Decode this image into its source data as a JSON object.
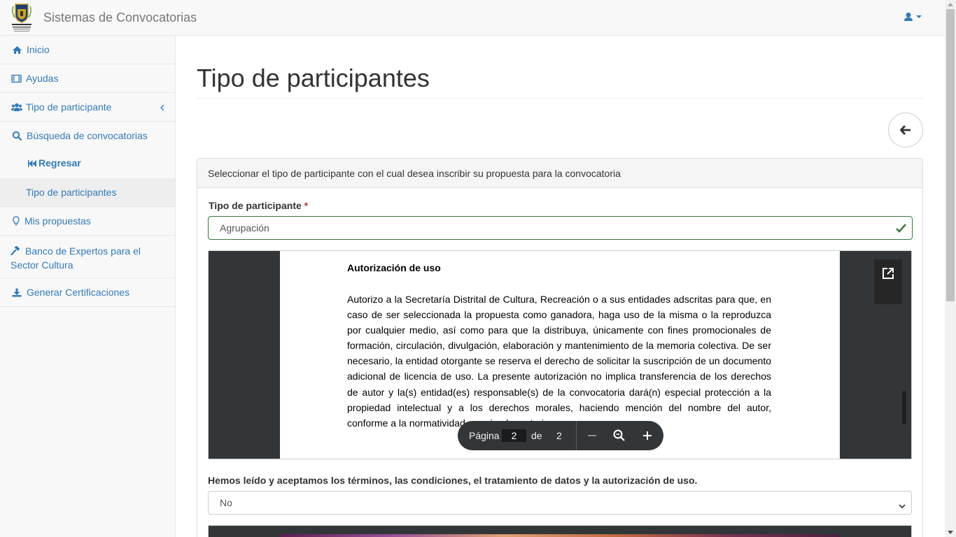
{
  "app": {
    "title": "Sistemas de Convocatorias",
    "logo_icon": "bogota-coat-of-arms-icon"
  },
  "sidebar": {
    "items": [
      {
        "label": "Inicio",
        "icon": "home-icon"
      },
      {
        "label": "Ayudas",
        "icon": "film-icon"
      },
      {
        "label": "Tipo de participante",
        "icon": "users-icon"
      },
      {
        "label": "Búsqueda de convocatorias",
        "icon": "search-icon"
      },
      {
        "label": "Regresar",
        "icon": "fast-backward-icon"
      },
      {
        "label": "Tipo de participantes"
      },
      {
        "label": "Mis propuestas",
        "icon": "lightbulb-icon"
      },
      {
        "label": "Banco de Expertos para el Sector Cultura",
        "icon": "gavel-icon"
      },
      {
        "label": "Generar Certificaciones",
        "icon": "download-icon"
      }
    ]
  },
  "main": {
    "title": "Tipo de participantes",
    "panel_heading": "Seleccionar el tipo de participante con el cual desea inscribir su propuesta para la convocatoria",
    "field_label": "Tipo de participante",
    "required_mark": "*",
    "field_value": "Agrupación",
    "terms_label": "Hemos leído y aceptamos los términos, las condiciones, el tratamiento de datos y la autorización de uso.",
    "terms_value": "No"
  },
  "pdf": {
    "heading": "Autorización de uso",
    "body": "Autorizo a la Secretaría Distrital de Cultura, Recreación o a sus entidades adscritas para que, en caso de ser seleccionada la propuesta como ganadora, haga uso de la misma o la reproduzca por cualquier medio, así como para que la distribuya, únicamente con fines promocionales de formación, circulación, divulgación, elaboración y mantenimiento de la memoria colectiva. De ser necesario, la entidad otorgante se reserva el derecho de solicitar la suscripción de un documento adicional de licencia de uso. La presente autorización no implica transferencia de los derechos de autor y la(s) entidad(es) responsable(s) de la convocatoria dará(n) especial protección a la propiedad intelectual y a los derechos morales, haciendo mención del nombre del autor, conforme a la normatividad que rige la materia.",
    "page_label": "Página",
    "current_page": "2",
    "of_label": "de",
    "total_pages": "2"
  },
  "colors": {
    "link": "#337ab7",
    "success": "#3c763d",
    "required": "#a94442"
  }
}
